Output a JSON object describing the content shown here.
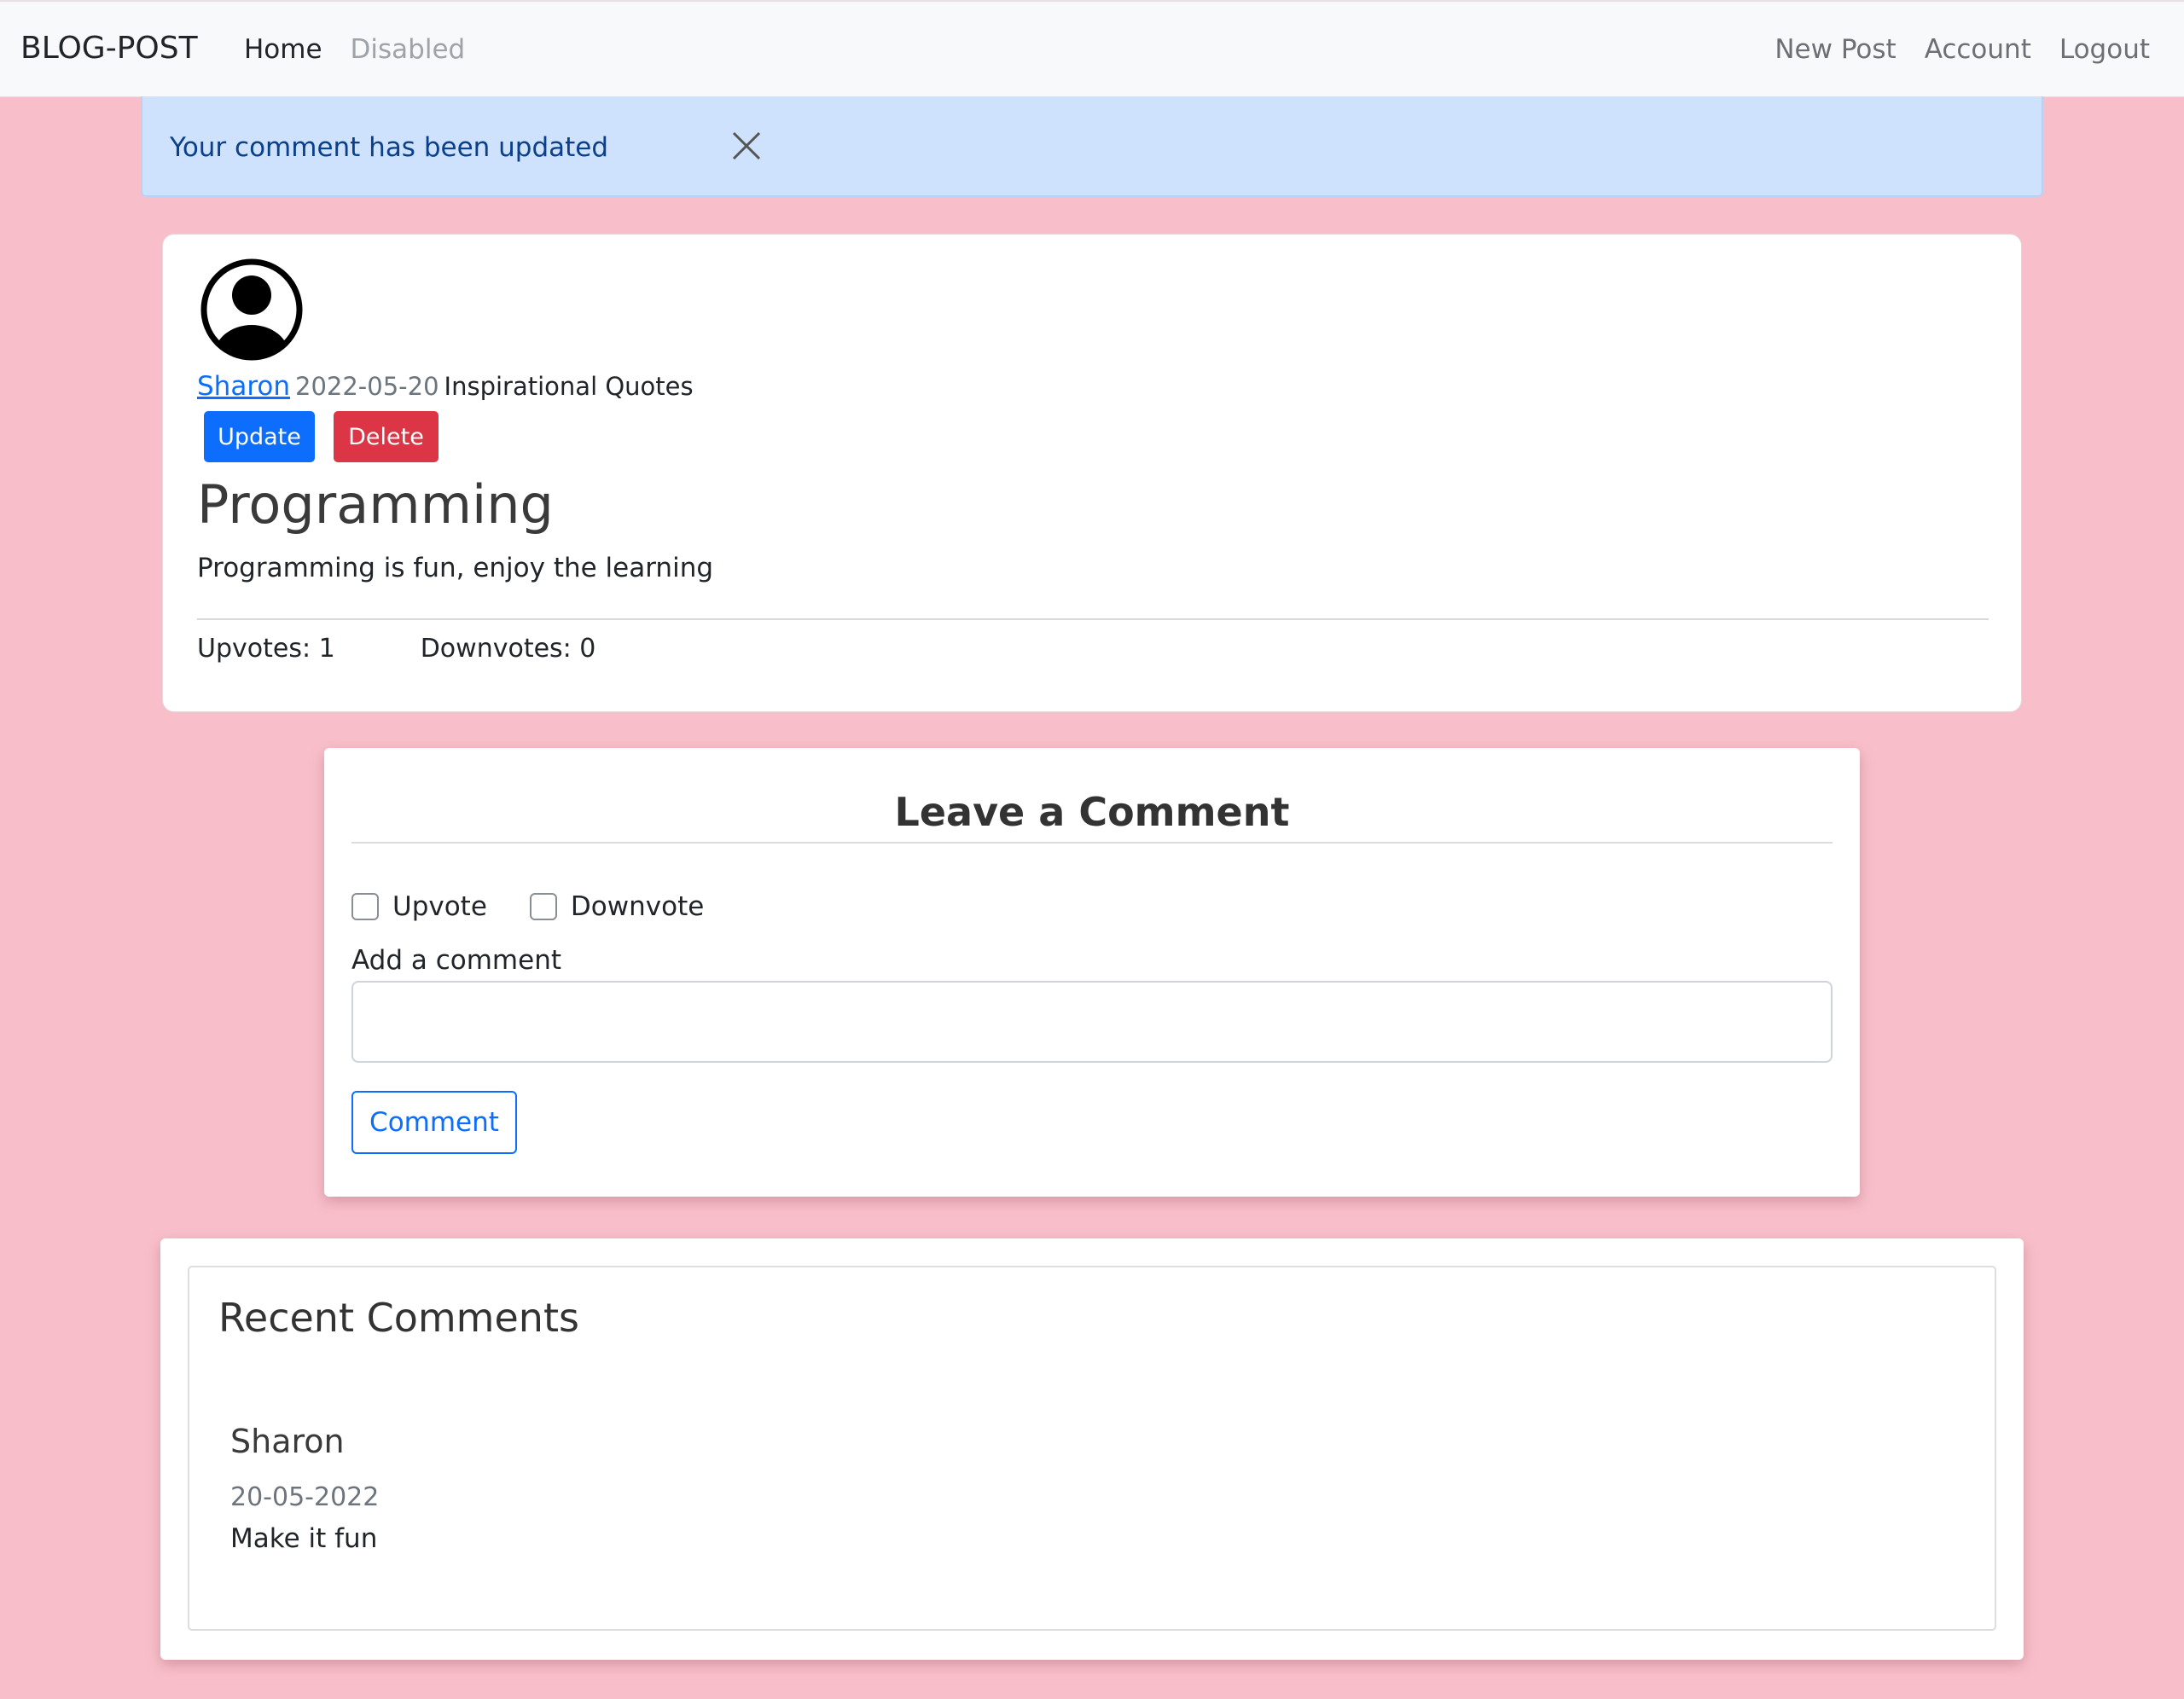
{
  "navbar": {
    "brand": "BLOG-POST",
    "left_links": [
      "Home",
      "Disabled"
    ],
    "right_links": [
      "New Post",
      "Account",
      "Logout"
    ]
  },
  "alert": {
    "message": "Your comment has been updated"
  },
  "post": {
    "author": "Sharon",
    "date": "2022-05-20",
    "category": "Inspirational Quotes",
    "update_label": "Update",
    "delete_label": "Delete",
    "title": "Programming",
    "body": "Programming is fun, enjoy the learning",
    "upvotes_label": "Upvotes: 1",
    "downvotes_label": "Downvotes: 0"
  },
  "comment_form": {
    "title": "Leave a Comment",
    "upvote_label": "Upvote",
    "downvote_label": "Downvote",
    "field_label": "Add a comment",
    "field_value": "",
    "submit_label": "Comment"
  },
  "recent_comments": {
    "title": "Recent Comments",
    "items": [
      {
        "author": "Sharon",
        "date": "20-05-2022",
        "text": "Make it fun"
      }
    ]
  },
  "colors": {
    "page_background": "#f8bfcb",
    "primary": "#0d6efd",
    "danger": "#dc3545",
    "alert_background": "#cfe2fd"
  }
}
